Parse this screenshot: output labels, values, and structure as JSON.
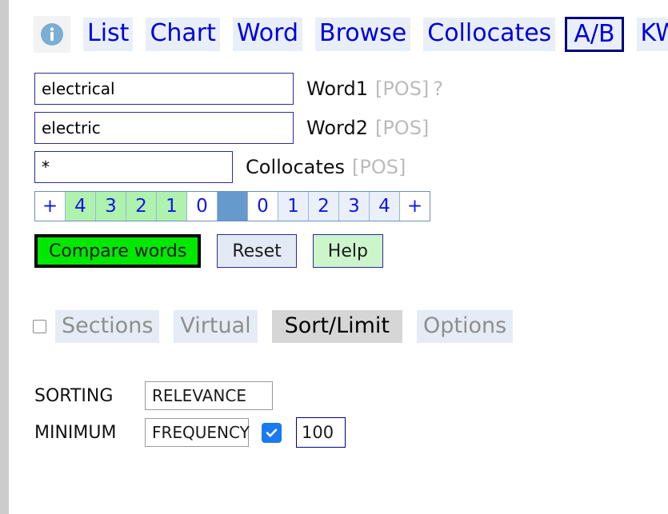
{
  "nav": {
    "info_icon": "info-icon",
    "tabs": [
      {
        "label": "List",
        "selected": false
      },
      {
        "label": "Chart",
        "selected": false
      },
      {
        "label": "Word",
        "selected": false
      },
      {
        "label": "Browse",
        "selected": false
      },
      {
        "label": "Collocates",
        "selected": false
      },
      {
        "label": "A/B",
        "selected": true
      },
      {
        "label": "KWIC",
        "selected": false
      },
      {
        "label": "-",
        "selected": false
      }
    ]
  },
  "form": {
    "word1": {
      "value": "electrical",
      "placeholder": "",
      "label": "Word1",
      "pos": "[POS]",
      "help": "?"
    },
    "word2": {
      "value": "electric",
      "placeholder": "",
      "label": "Word2",
      "pos": "[POS]"
    },
    "collocates": {
      "value": "*",
      "placeholder": "",
      "label": "Collocates",
      "pos": "[POS]"
    },
    "distance": {
      "cells": [
        {
          "label": "+",
          "style": "white"
        },
        {
          "label": "4",
          "style": "green"
        },
        {
          "label": "3",
          "style": "green"
        },
        {
          "label": "2",
          "style": "green"
        },
        {
          "label": "1",
          "style": "green"
        },
        {
          "label": "0",
          "style": "white"
        },
        {
          "label": "",
          "style": "center"
        },
        {
          "label": "0",
          "style": "white"
        },
        {
          "label": "1",
          "style": "blue"
        },
        {
          "label": "2",
          "style": "blue"
        },
        {
          "label": "3",
          "style": "blue"
        },
        {
          "label": "4",
          "style": "blue"
        },
        {
          "label": "+",
          "style": "white"
        }
      ]
    },
    "buttons": {
      "compare": "Compare words",
      "reset": "Reset",
      "help": "Help"
    }
  },
  "sections": {
    "checkbox_checked": false,
    "tabs": [
      {
        "label": "Sections",
        "active": false
      },
      {
        "label": "Virtual",
        "active": false
      },
      {
        "label": "Sort/Limit",
        "active": true
      },
      {
        "label": "Options",
        "active": false
      }
    ]
  },
  "sortlimit": {
    "sorting_label": "SORTING",
    "sorting_value": "RELEVANCE",
    "minimum_label": "MINIMUM",
    "minimum_value": "FREQUENCY",
    "minimum_enabled": true,
    "minimum_count": "100"
  },
  "colors": {
    "accent_blue": "#0000dd",
    "selected_border": "#000080",
    "primary_button": "#00e800",
    "green_cell": "#aef2ae",
    "center_cell": "#6699cc",
    "active_tab_bg": "#d6d6d6",
    "checkbox_on": "#1a7aef"
  }
}
